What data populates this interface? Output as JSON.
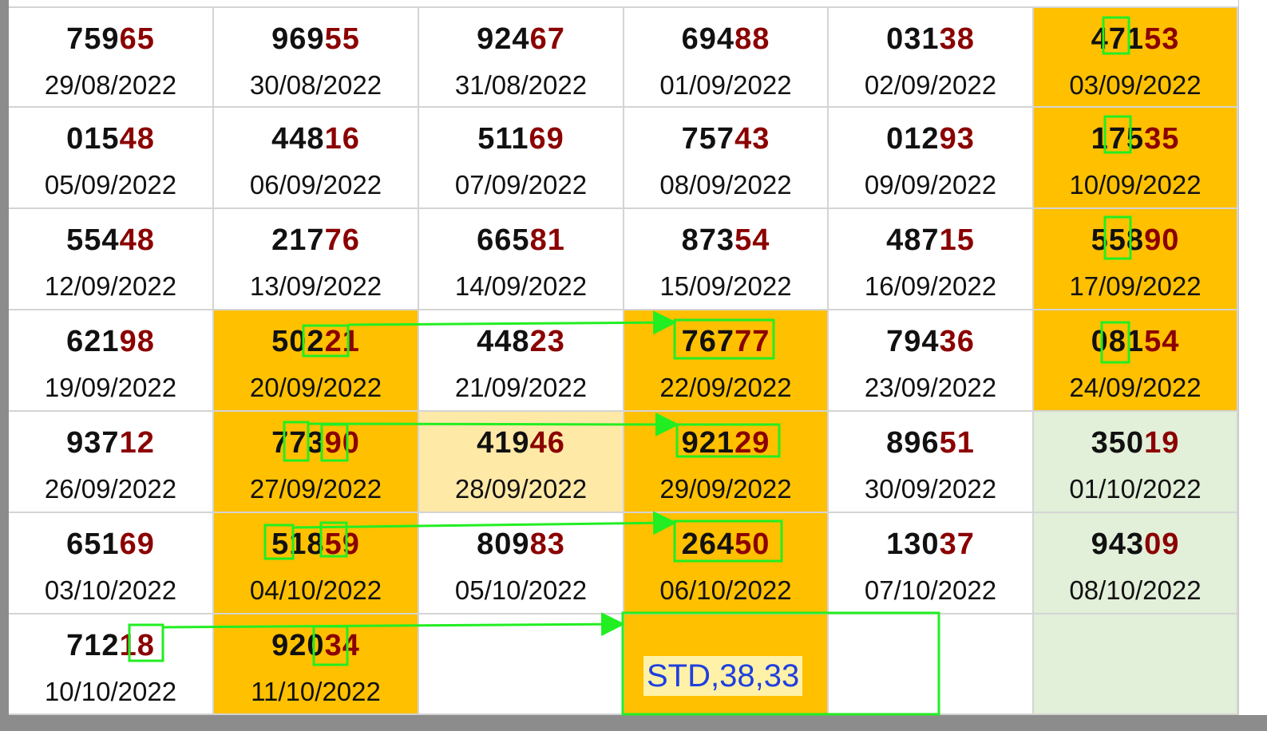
{
  "sheet": {
    "rows": [
      [
        {
          "head": "759",
          "tail": "65",
          "date": "29/08/2022",
          "fill": "white"
        },
        {
          "head": "969",
          "tail": "55",
          "date": "30/08/2022",
          "fill": "white"
        },
        {
          "head": "924",
          "tail": "67",
          "date": "31/08/2022",
          "fill": "white"
        },
        {
          "head": "694",
          "tail": "88",
          "date": "01/09/2022",
          "fill": "white"
        },
        {
          "head": "031",
          "tail": "38",
          "date": "02/09/2022",
          "fill": "white"
        },
        {
          "head": "471",
          "tail": "53",
          "date": "03/09/2022",
          "fill": "orange"
        }
      ],
      [
        {
          "head": "015",
          "tail": "48",
          "date": "05/09/2022",
          "fill": "white"
        },
        {
          "head": "448",
          "tail": "16",
          "date": "06/09/2022",
          "fill": "white"
        },
        {
          "head": "511",
          "tail": "69",
          "date": "07/09/2022",
          "fill": "white"
        },
        {
          "head": "757",
          "tail": "43",
          "date": "08/09/2022",
          "fill": "white"
        },
        {
          "head": "012",
          "tail": "93",
          "date": "09/09/2022",
          "fill": "white"
        },
        {
          "head": "175",
          "tail": "35",
          "date": "10/09/2022",
          "fill": "orange"
        }
      ],
      [
        {
          "head": "554",
          "tail": "48",
          "date": "12/09/2022",
          "fill": "white"
        },
        {
          "head": "217",
          "tail": "76",
          "date": "13/09/2022",
          "fill": "white"
        },
        {
          "head": "665",
          "tail": "81",
          "date": "14/09/2022",
          "fill": "white"
        },
        {
          "head": "873",
          "tail": "54",
          "date": "15/09/2022",
          "fill": "white"
        },
        {
          "head": "487",
          "tail": "15",
          "date": "16/09/2022",
          "fill": "white"
        },
        {
          "head": "558",
          "tail": "90",
          "date": "17/09/2022",
          "fill": "orange"
        }
      ],
      [
        {
          "head": "621",
          "tail": "98",
          "date": "19/09/2022",
          "fill": "white"
        },
        {
          "head": "502",
          "tail": "21",
          "date": "20/09/2022",
          "fill": "orange"
        },
        {
          "head": "448",
          "tail": "23",
          "date": "21/09/2022",
          "fill": "white"
        },
        {
          "head": "767",
          "tail": "77",
          "date": "22/09/2022",
          "fill": "orange"
        },
        {
          "head": "794",
          "tail": "36",
          "date": "23/09/2022",
          "fill": "white"
        },
        {
          "head": "081",
          "tail": "54",
          "date": "24/09/2022",
          "fill": "orange"
        }
      ],
      [
        {
          "head": "937",
          "tail": "12",
          "date": "26/09/2022",
          "fill": "white"
        },
        {
          "head": "773",
          "tail": "90",
          "date": "27/09/2022",
          "fill": "orange"
        },
        {
          "head": "419",
          "tail": "46",
          "date": "28/09/2022",
          "fill": "lightorange"
        },
        {
          "head": "921",
          "tail": "29",
          "date": "29/09/2022",
          "fill": "orange"
        },
        {
          "head": "896",
          "tail": "51",
          "date": "30/09/2022",
          "fill": "white"
        },
        {
          "head": "350",
          "tail": "19",
          "date": "01/10/2022",
          "fill": "green"
        }
      ],
      [
        {
          "head": "651",
          "tail": "69",
          "date": "03/10/2022",
          "fill": "white"
        },
        {
          "head": "518",
          "tail": "59",
          "date": "04/10/2022",
          "fill": "orange"
        },
        {
          "head": "809",
          "tail": "83",
          "date": "05/10/2022",
          "fill": "white"
        },
        {
          "head": "264",
          "tail": "50",
          "date": "06/10/2022",
          "fill": "orange"
        },
        {
          "head": "130",
          "tail": "37",
          "date": "07/10/2022",
          "fill": "white"
        },
        {
          "head": "943",
          "tail": "09",
          "date": "08/10/2022",
          "fill": "green"
        }
      ],
      [
        {
          "head": "712",
          "tail": "18",
          "date": "10/10/2022",
          "fill": "white"
        },
        {
          "head": "920",
          "tail": "34",
          "date": "11/10/2022",
          "fill": "orange"
        },
        {
          "head": "",
          "tail": "",
          "date": "",
          "fill": "white"
        },
        {
          "head": "",
          "tail": "",
          "date": "",
          "fill": "orange"
        },
        {
          "head": "",
          "tail": "",
          "date": "",
          "fill": "white"
        },
        {
          "head": "",
          "tail": "",
          "date": "",
          "fill": "green"
        }
      ]
    ]
  },
  "prediction": {
    "label": "STD,38,33"
  },
  "colors": {
    "cell_orange": "#ffc000",
    "cell_light_orange": "#ffe9a7",
    "cell_green": "#e2efd9",
    "digit_dark": "#111111",
    "digit_tail_red": "#8b0000",
    "highlight_box": "#22ee22",
    "prediction_text": "#1f3fe0",
    "prediction_bg": "#fff2a8"
  }
}
